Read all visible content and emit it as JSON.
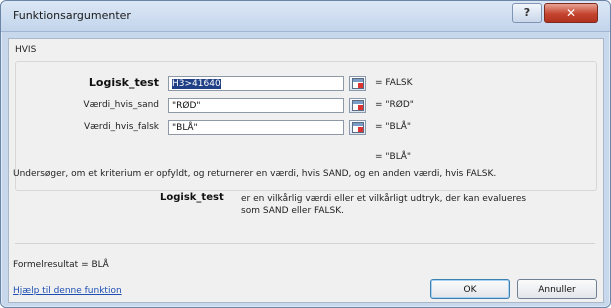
{
  "window": {
    "title": "Funktionsargumenter",
    "help_glyph": "?",
    "close_glyph": "✕"
  },
  "function": {
    "name": "HVIS",
    "args": [
      {
        "label": "Logisk_test",
        "value_selected": "H3>41640",
        "value_rest": "",
        "result": "=  FALSK",
        "bold": true
      },
      {
        "label": "Værdi_hvis_sand",
        "value_selected": "",
        "value_rest": "\"RØD\"",
        "result": "=  \"RØD\"",
        "bold": false
      },
      {
        "label": "Værdi_hvis_falsk",
        "value_selected": "",
        "value_rest": "\"BLÅ\"",
        "result": "=  \"BLÅ\"",
        "bold": false
      }
    ],
    "overall_result": "=  \"BLÅ\"",
    "description": "Undersøger, om et kriterium er opfyldt, og returnerer en værdi, hvis SAND, og en anden værdi, hvis FALSK.",
    "arg_desc_name": "Logisk_test",
    "arg_desc_text": "er en vilkårlig værdi eller et vilkårligt udtryk, der kan evalueres som SAND eller FALSK."
  },
  "footer": {
    "formula_result": "Formelresultat =  BLÅ",
    "help_link": "Hjælp til denne funktion",
    "ok_label": "OK",
    "cancel_label": "Annuller"
  },
  "colors": {
    "selection": "#1f3f86",
    "link": "#1d4fb3",
    "close_button": "#c4442f"
  }
}
